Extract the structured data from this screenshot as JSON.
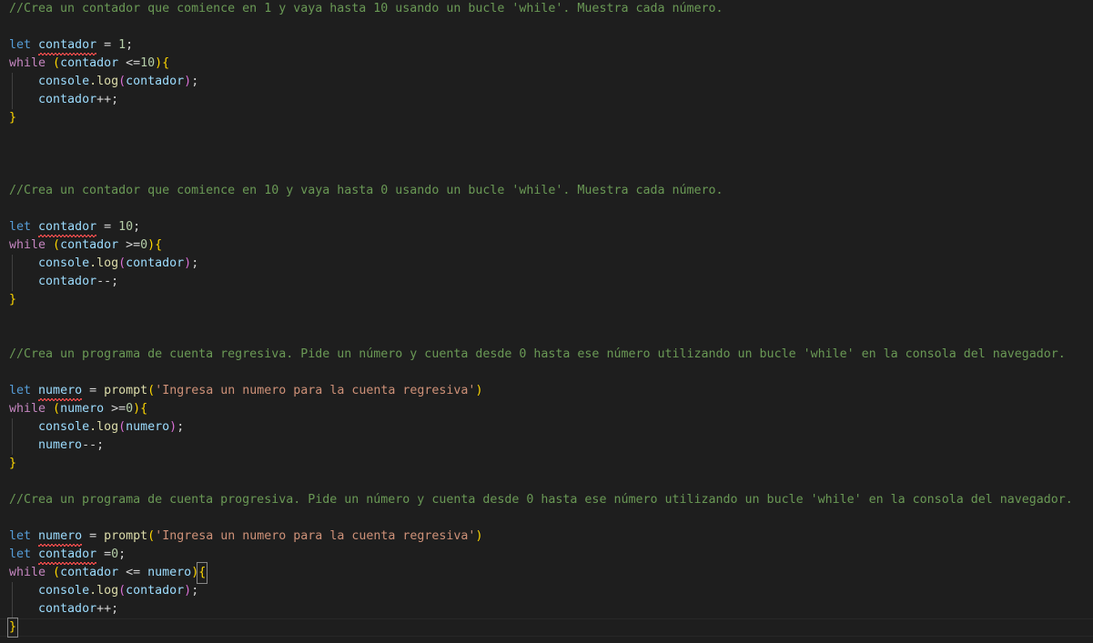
{
  "editor": {
    "language": "javascript",
    "theme": "Dark+ (default dark)",
    "background": "#1e1e1e",
    "foreground": "#d4d4d4",
    "colors": {
      "comment": "#6a9955",
      "keyword": "#569cd6",
      "control": "#c586c0",
      "variable": "#9cdcfe",
      "function": "#dcdcaa",
      "number": "#b5cea8",
      "string": "#ce9178",
      "bracket_gold": "#ffd700",
      "bracket_magenta": "#da70d6",
      "bracket_blue": "#179fff",
      "error_squiggle": "#f14c4c",
      "indent_guide": "#404040",
      "current_line_border": "#282828"
    }
  },
  "code": {
    "block1": {
      "comment": "//Crea un contador que comience en 1 y vaya hasta 10 usando un bucle 'while'. Muestra cada número.",
      "let": "let",
      "var": "contador",
      "assign": " = ",
      "init": "1",
      "semi": ";",
      "while": "while",
      "open_paren": "(",
      "cond_var": "contador",
      "operator": " <=",
      "limit": "10",
      "close_paren": ")",
      "open_brace": "{",
      "console": "console",
      "dot_log": ".log",
      "log_open": "(",
      "log_arg": "contador",
      "log_close": ")",
      "log_semi": ";",
      "incr_var": "contador",
      "incr_op": "++;",
      "close_brace": "}"
    },
    "block2": {
      "comment": "//Crea un contador que comience en 10 y vaya hasta 0 usando un bucle 'while'. Muestra cada número.",
      "let": "let",
      "var": "contador",
      "assign": " = ",
      "init": "10",
      "semi": ";",
      "while": "while",
      "open_paren": "(",
      "cond_var": "contador",
      "operator": " >=",
      "limit": "0",
      "close_paren": ")",
      "open_brace": "{",
      "console": "console",
      "dot_log": ".log",
      "log_open": "(",
      "log_arg": "contador",
      "log_close": ")",
      "log_semi": ";",
      "incr_var": "contador",
      "incr_op": "--;",
      "close_brace": "}"
    },
    "block3": {
      "comment": "//Crea un programa de cuenta regresiva. Pide un número y cuenta desde 0 hasta ese número utilizando un bucle 'while' en la consola del navegador.",
      "let": "let",
      "var": "numero",
      "assign": " = ",
      "fn": "prompt",
      "fn_open": "(",
      "fn_arg": "'Ingresa un numero para la cuenta regresiva'",
      "fn_close": ")",
      "while": "while",
      "open_paren": "(",
      "cond_var": "numero",
      "operator": " >=",
      "limit": "0",
      "close_paren": ")",
      "open_brace": "{",
      "console": "console",
      "dot_log": ".log",
      "log_open": "(",
      "log_arg": "numero",
      "log_close": ")",
      "log_semi": ";",
      "incr_var": "numero",
      "incr_op": "--;",
      "close_brace": "}"
    },
    "block4": {
      "comment": "//Crea un programa de cuenta progresiva. Pide un número y cuenta desde 0 hasta ese número utilizando un bucle 'while' en la consola del navegador.",
      "let": "let",
      "var": "numero",
      "assign": " = ",
      "fn": "prompt",
      "fn_open": "(",
      "fn_arg": "'Ingresa un numero para la cuenta regresiva'",
      "fn_close": ")",
      "let2": "let",
      "var2": "contador",
      "assign2": " =",
      "init2": "0",
      "semi2": ";",
      "while": "while",
      "open_paren": "(",
      "cond_var": "contador",
      "operator": " <= ",
      "limit_var": "numero",
      "close_paren": ")",
      "open_brace": "{",
      "console": "console",
      "dot_log": ".log",
      "log_open": "(",
      "log_arg": "contador",
      "log_close": ")",
      "log_semi": ";",
      "incr_var": "contador",
      "incr_op": "++;",
      "close_brace": "}"
    }
  }
}
